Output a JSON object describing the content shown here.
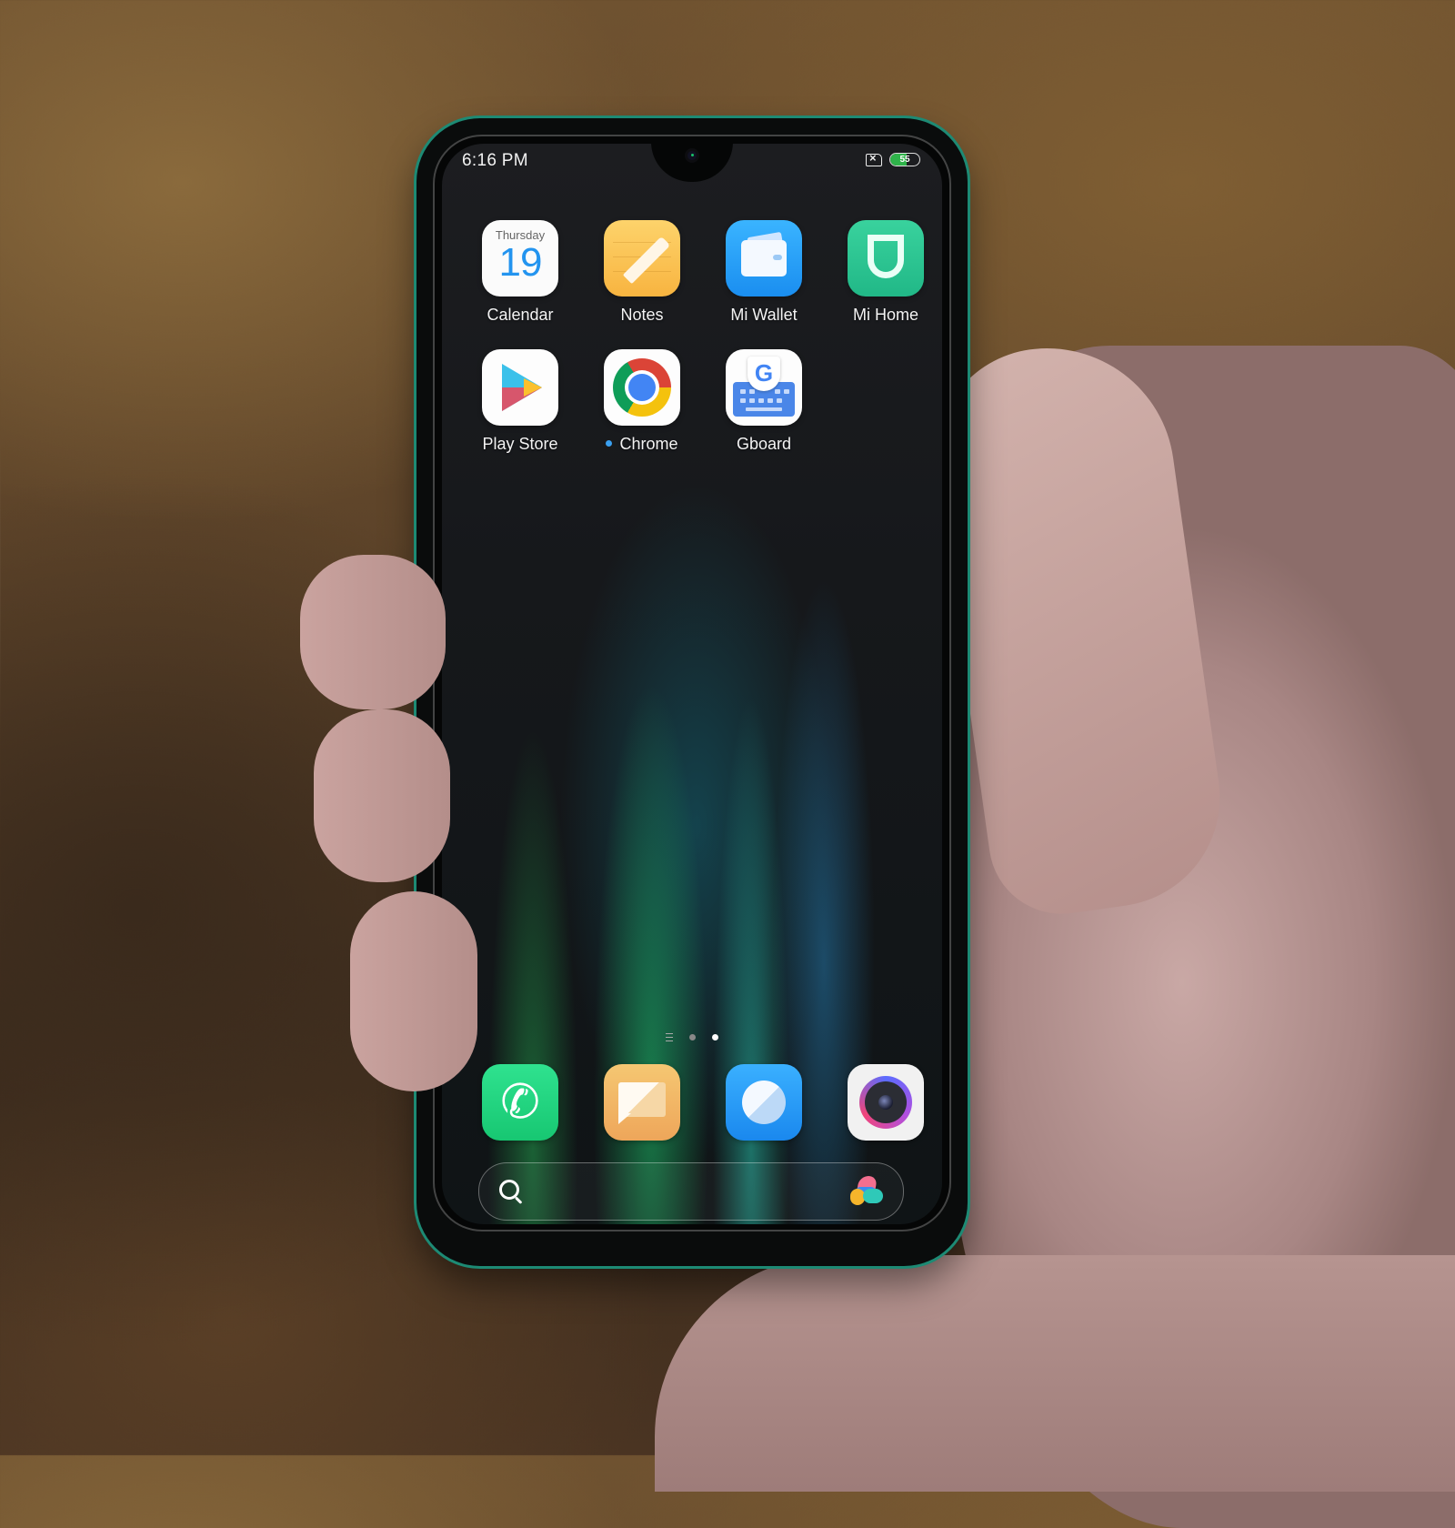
{
  "status_bar": {
    "time": "6:16 PM",
    "sim_icon": "no-sim-icon",
    "battery_level": 55,
    "battery_label": "55"
  },
  "home_apps": [
    {
      "label": "Calendar",
      "icon": "calendar-icon",
      "calendar_day": "Thursday",
      "calendar_date": "19"
    },
    {
      "label": "Notes",
      "icon": "notes-icon"
    },
    {
      "label": "Mi Wallet",
      "icon": "wallet-icon"
    },
    {
      "label": "Mi Home",
      "icon": "mi-home-icon"
    },
    {
      "label": "Play Store",
      "icon": "play-store-icon"
    },
    {
      "label": "Chrome",
      "icon": "chrome-icon",
      "new_badge": true
    },
    {
      "label": "Gboard",
      "icon": "gboard-icon",
      "glyph": "G"
    }
  ],
  "pager": {
    "pages": 2,
    "active_page": 2,
    "list_indicator": "app-list-icon"
  },
  "dock": [
    {
      "name": "Phone",
      "icon": "phone-icon",
      "glyph": "✆"
    },
    {
      "name": "Messaging",
      "icon": "messaging-icon"
    },
    {
      "name": "Browser",
      "icon": "browser-icon"
    },
    {
      "name": "Camera",
      "icon": "camera-icon"
    }
  ],
  "search_bar": {
    "search_icon": "search-icon",
    "assistant_icon": "app-vault-icon"
  },
  "nav_bar": {
    "menu": "menu-icon",
    "home": "home-icon",
    "back_glyph": "‹"
  }
}
